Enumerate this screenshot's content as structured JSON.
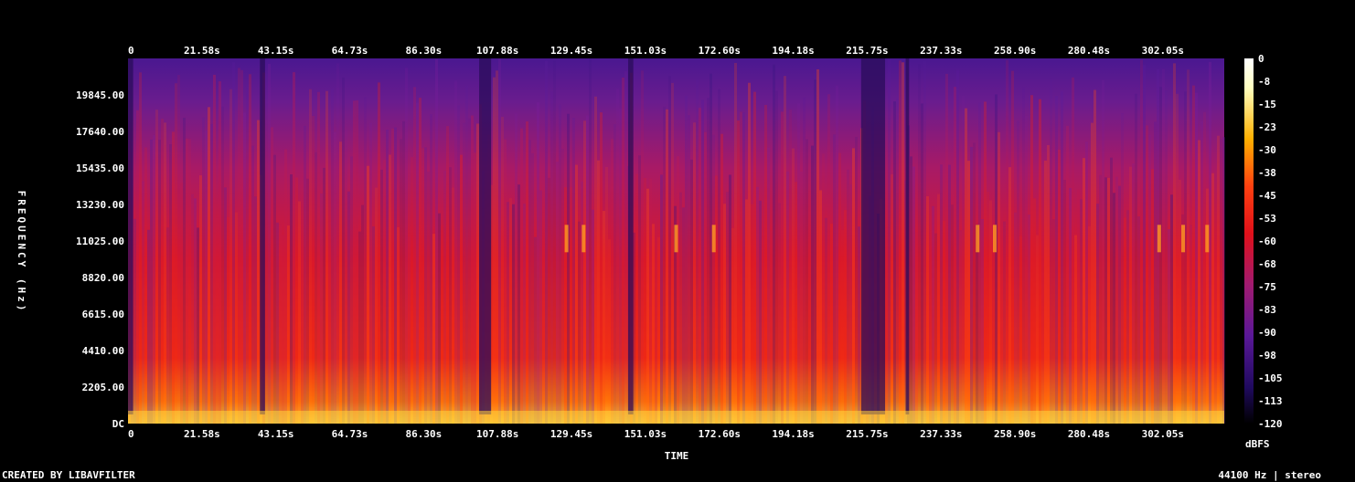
{
  "chart_data": {
    "type": "heatmap",
    "xlabel": "TIME",
    "ylabel": "FREQUENCY (Hz)",
    "x_ticks": [
      "0",
      "21.58s",
      "43.15s",
      "64.73s",
      "86.30s",
      "107.88s",
      "129.45s",
      "151.03s",
      "172.60s",
      "194.18s",
      "215.75s",
      "237.33s",
      "258.90s",
      "280.48s",
      "302.05s"
    ],
    "y_ticks": [
      "DC",
      "2205.00",
      "4410.00",
      "6615.00",
      "8820.00",
      "11025.00",
      "13230.00",
      "15435.00",
      "17640.00",
      "19845.00"
    ],
    "xlim": [
      0,
      320
    ],
    "ylim": [
      0,
      22050
    ],
    "colorbar": {
      "label": "dBFS",
      "range": [
        -120,
        0
      ],
      "ticks": [
        "0",
        "-8",
        "-15",
        "-23",
        "-30",
        "-38",
        "-45",
        "-53",
        "-60",
        "-68",
        "-75",
        "-83",
        "-90",
        "-98",
        "-105",
        "-113",
        "-120"
      ]
    },
    "colormap": [
      "#000000",
      "#1a0550",
      "#4b1896",
      "#7a1ea0",
      "#b01a6a",
      "#e01a28",
      "#ff3a10",
      "#ff8a00",
      "#ffd040",
      "#ffffc0"
    ],
    "quiet_segments_s": [
      [
        0,
        1.5
      ],
      [
        38.5,
        40
      ],
      [
        102.5,
        106
      ],
      [
        146,
        147.5
      ],
      [
        214,
        221
      ],
      [
        227,
        228
      ]
    ],
    "bright_peaks_s": [
      128,
      133,
      160,
      171,
      248,
      253,
      301,
      308,
      315
    ]
  },
  "footer": {
    "left": "CREATED BY LIBAVFILTER",
    "right": "44100 Hz | stereo"
  }
}
